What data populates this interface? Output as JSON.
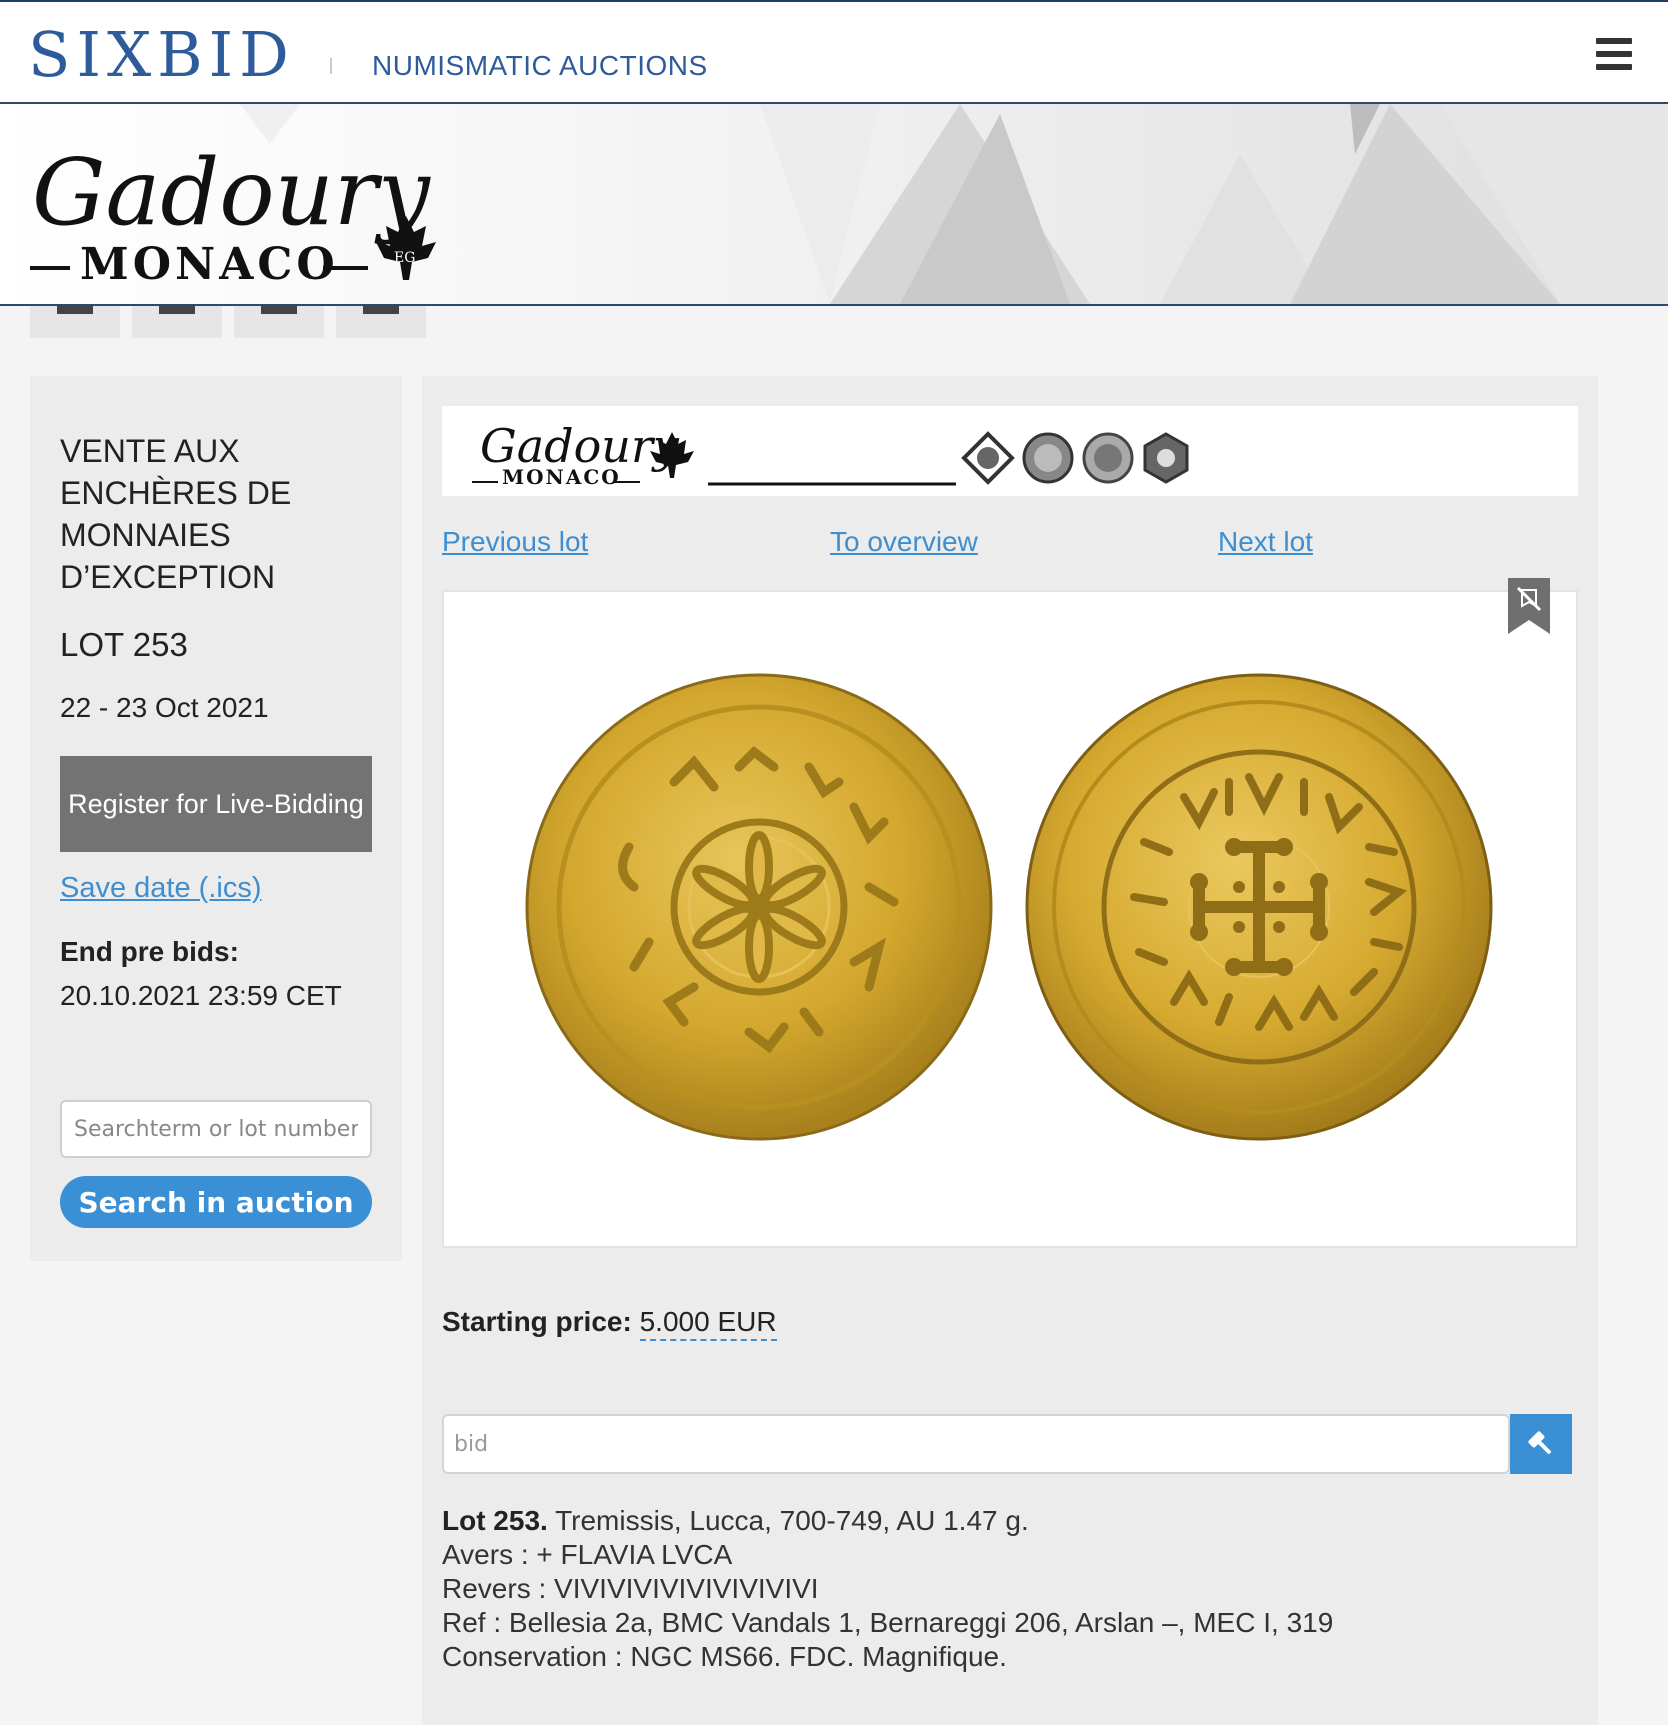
{
  "header": {
    "brand": "SIXBID",
    "subtitle": "NUMISMATIC AUCTIONS"
  },
  "banner": {
    "logo_main": "Gadoury",
    "logo_sub": "MONACO",
    "logo_mark": "EG"
  },
  "sidebar": {
    "auction_title": "VENTE AUX ENCHÈRES DE MONNAIES D’EXCEPTION",
    "lot_label": "LOT 253",
    "dates": "22 - 23 Oct 2021",
    "register_button": "Register for Live-Bidding",
    "save_date_link": "Save date (.ics)",
    "end_prebids_label": "End pre bids:",
    "end_prebids_value": "20.10.2021 23:59 CET",
    "search_placeholder": "Searchterm or lot number",
    "search_button": "Search in auction"
  },
  "main": {
    "previous_lot": "Previous lot",
    "to_overview": "To overview",
    "next_lot": "Next lot",
    "starting_price_label": "Starting price:",
    "starting_price_value": "5.000 EUR",
    "bid_placeholder": "bid",
    "description": {
      "lot_number": "Lot 253.",
      "line1": "Tremissis, Lucca, 700-749, AU 1.47 g.",
      "line2": "Avers : + FLAVIA LVCA",
      "line3": "Revers : VIVIVIVIVIVIVIVIVIVI",
      "line4": "Ref : Bellesia 2a, BMC Vandals 1, Bernareggi 206, Arslan –, MEC I, 319",
      "line5": "Conservation : NGC MS66. FDC. Magnifique."
    }
  },
  "icons": {
    "menu": "hamburger-menu-icon",
    "bookmark": "bookmark-icon",
    "bid": "gavel-icon"
  },
  "colors": {
    "brand_blue": "#2e5b9a",
    "link_blue": "#3e8ed0",
    "button_blue": "#3a8fd5",
    "register_gray": "#737373",
    "coin_gold": "#d4a82e"
  }
}
